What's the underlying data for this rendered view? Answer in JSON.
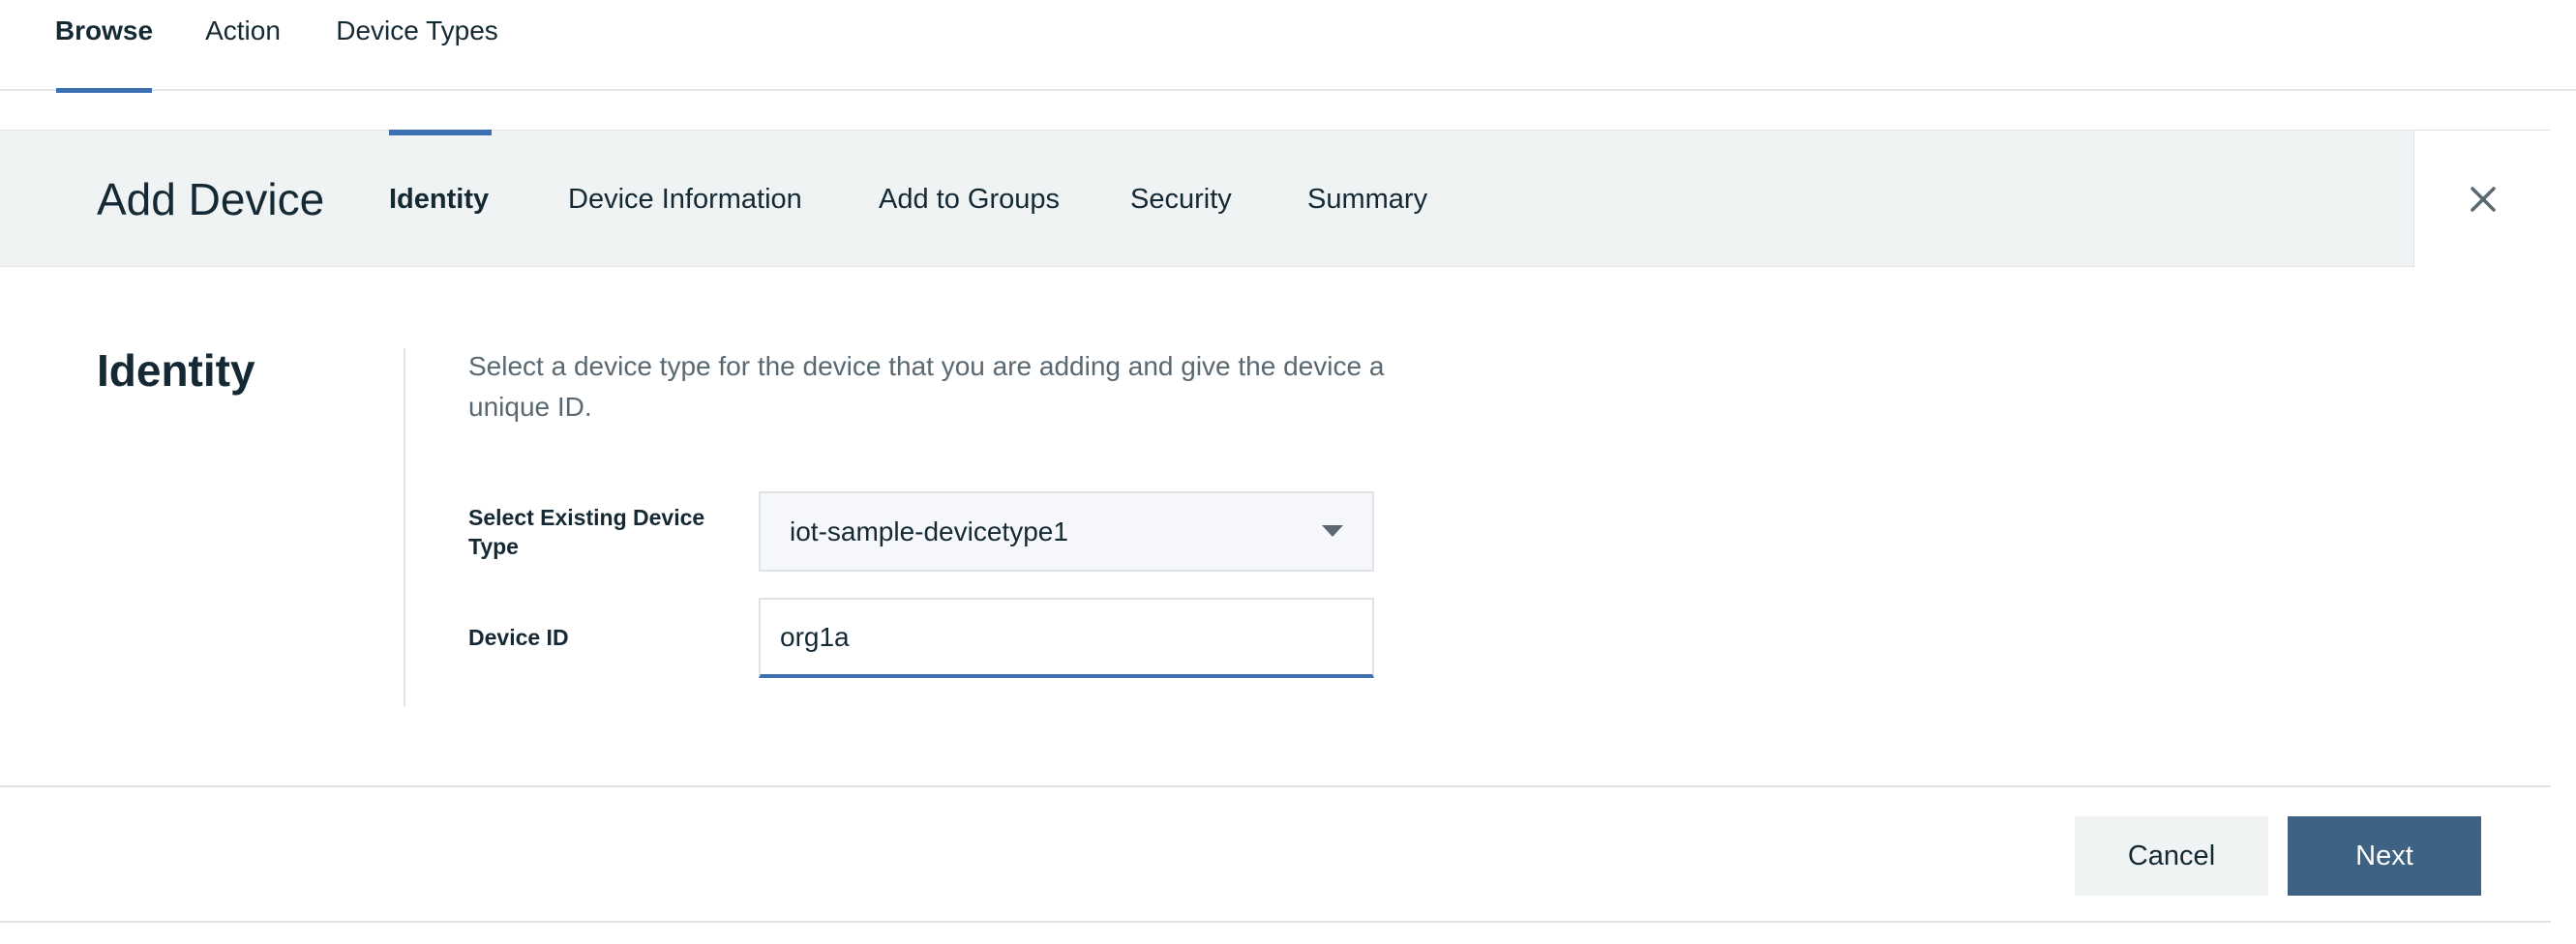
{
  "top_nav": {
    "tabs": [
      {
        "label": "Browse",
        "active": true
      },
      {
        "label": "Action",
        "active": false
      },
      {
        "label": "Device Types",
        "active": false
      }
    ]
  },
  "wizard": {
    "title": "Add Device",
    "steps": [
      {
        "label": "Identity",
        "active": true
      },
      {
        "label": "Device Information",
        "active": false
      },
      {
        "label": "Add to Groups",
        "active": false
      },
      {
        "label": "Security",
        "active": false
      },
      {
        "label": "Summary",
        "active": false
      }
    ],
    "close_icon": "close-icon"
  },
  "identity": {
    "section_title": "Identity",
    "description": "Select a device type for the device that you are adding and give the device a unique ID.",
    "device_type_label": "Select Existing Device Type",
    "device_type_value": "iot-sample-devicetype1",
    "device_id_label": "Device ID",
    "device_id_value": "org1a"
  },
  "footer": {
    "cancel_label": "Cancel",
    "next_label": "Next"
  },
  "colors": {
    "accent": "#3d70b2",
    "primary_button": "#3d6283",
    "header_bg": "#eff3f4",
    "text": "#152935",
    "muted_text": "#5a6872"
  }
}
